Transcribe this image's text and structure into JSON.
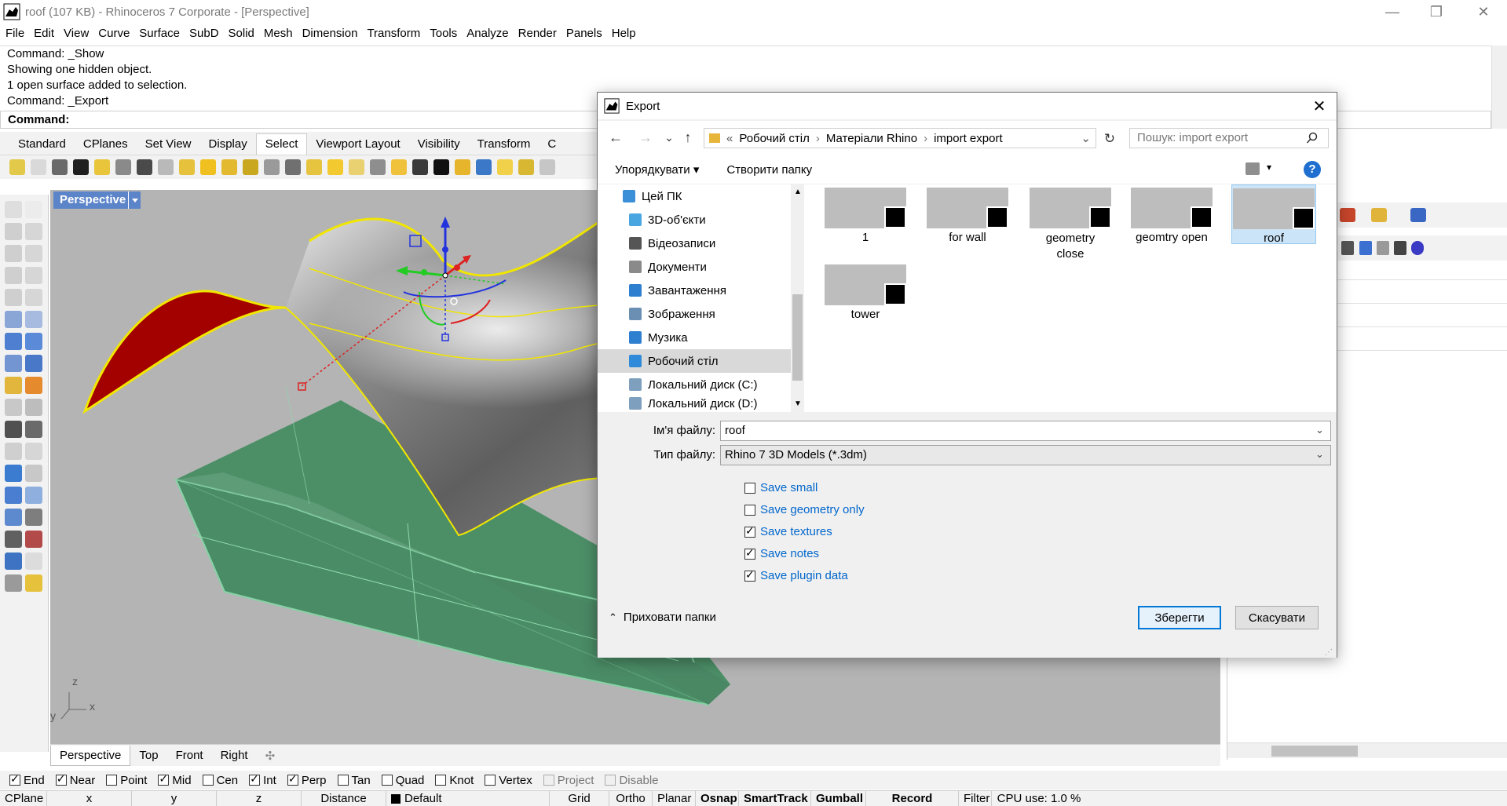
{
  "window": {
    "title": "roof (107 KB) - Rhinoceros 7 Corporate - [Perspective]",
    "minimize": "—",
    "restore": "❐",
    "close": "✕"
  },
  "menu": [
    "File",
    "Edit",
    "View",
    "Curve",
    "Surface",
    "SubD",
    "Solid",
    "Mesh",
    "Dimension",
    "Transform",
    "Tools",
    "Analyze",
    "Render",
    "Panels",
    "Help"
  ],
  "command": {
    "history": [
      "Command: _Show",
      "Showing one hidden object.",
      "1 open surface added to selection.",
      "Command: _Export"
    ],
    "prompt": "Command:"
  },
  "toolbar_tabs": [
    "Standard",
    "CPlanes",
    "Set View",
    "Display",
    "Select",
    "Viewport Layout",
    "Visibility",
    "Transform",
    "C"
  ],
  "toolbar_active_tab": "Select",
  "viewport": {
    "label": "Perspective",
    "axes": {
      "z": "z",
      "y": "y",
      "x": "x"
    }
  },
  "viewport_tabs": [
    "Perspective",
    "Top",
    "Front",
    "Right"
  ],
  "viewport_add": "✣",
  "osnap": [
    {
      "label": "End",
      "checked": true
    },
    {
      "label": "Near",
      "checked": true
    },
    {
      "label": "Point",
      "checked": false
    },
    {
      "label": "Mid",
      "checked": true
    },
    {
      "label": "Cen",
      "checked": false
    },
    {
      "label": "Int",
      "checked": true
    },
    {
      "label": "Perp",
      "checked": true
    },
    {
      "label": "Tan",
      "checked": false
    },
    {
      "label": "Quad",
      "checked": false
    },
    {
      "label": "Knot",
      "checked": false
    },
    {
      "label": "Vertex",
      "checked": false
    },
    {
      "label": "Project",
      "checked": false,
      "disabled": true
    },
    {
      "label": "Disable",
      "checked": false,
      "disabled": true
    }
  ],
  "status": {
    "cplane": "CPlane",
    "x": "x",
    "y": "y",
    "z": "z",
    "distance": "Distance",
    "layer": "Default",
    "grid_snap": "Grid Snap",
    "ortho": "Ortho",
    "planar": "Planar",
    "osnap": "Osnap",
    "smarttrack": "SmartTrack",
    "gumball": "Gumball",
    "record_history": "Record History",
    "filter": "Filter",
    "cpu": "CPU use: 1.0 %"
  },
  "dialog": {
    "title": "Export",
    "close": "✕",
    "back": "←",
    "forward": "→",
    "recent": "⌄",
    "up": "↑",
    "breadcrumb_prefix": "«",
    "breadcrumb": [
      "Робочий стіл",
      "Матеріали Rhino",
      "import export"
    ],
    "refresh": "↻",
    "search_placeholder": "Пошук: import export",
    "organize": "Упорядкувати ▾",
    "new_folder": "Створити папку",
    "help": "?",
    "nav": [
      {
        "label": "Цей ПК",
        "color": "#3b8fd8"
      },
      {
        "label": "3D-об'єкти",
        "color": "#49a6e0"
      },
      {
        "label": "Відеозаписи",
        "color": "#555555"
      },
      {
        "label": "Документи",
        "color": "#8a8a8a"
      },
      {
        "label": "Завантаження",
        "color": "#2f7fd1"
      },
      {
        "label": "Зображення",
        "color": "#6b8fb3"
      },
      {
        "label": "Музика",
        "color": "#2f7fd1"
      },
      {
        "label": "Робочий стіл",
        "color": "#2f8ad9",
        "selected": true
      },
      {
        "label": "Локальний диск (C:)",
        "color": "#7f9fbf"
      },
      {
        "label": "Локальний диск (D:)",
        "color": "#7f9fbf"
      }
    ],
    "files": [
      {
        "name": "1"
      },
      {
        "name": "for wall"
      },
      {
        "name": "geometry close"
      },
      {
        "name": "geomtry open"
      },
      {
        "name": "roof",
        "selected": true
      },
      {
        "name": "tower"
      }
    ],
    "filename_label": "Ім'я файлу:",
    "filename_value": "roof",
    "filetype_label": "Тип файлу:",
    "filetype_value": "Rhino 7 3D Models (*.3dm)",
    "options": [
      {
        "label": "Save small",
        "checked": false
      },
      {
        "label": "Save geometry only",
        "checked": false
      },
      {
        "label": "Save textures",
        "checked": true
      },
      {
        "label": "Save notes",
        "checked": true
      },
      {
        "label": "Save plugin data",
        "checked": true
      }
    ],
    "hide_folders": "Приховати папки",
    "save": "Зберегти",
    "cancel": "Скасувати"
  }
}
